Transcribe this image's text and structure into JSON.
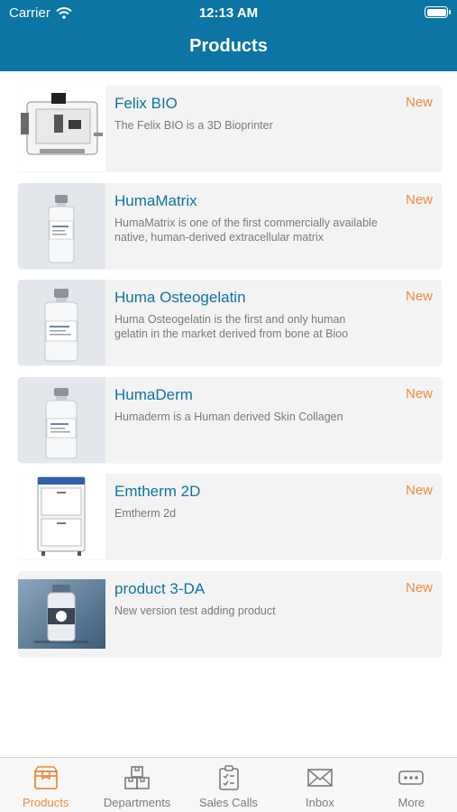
{
  "status_bar": {
    "carrier": "Carrier",
    "time": "12:13 AM"
  },
  "header": {
    "title": "Products"
  },
  "products": [
    {
      "name": "Felix BIO",
      "badge": "New",
      "description": "The Felix BIO is a 3D Bioprinter"
    },
    {
      "name": "HumaMatrix",
      "badge": "New",
      "description": "HumaMatrix is one of the first commercially available native, human-derived extracellular matrix"
    },
    {
      "name": "Huma Osteogelatin",
      "badge": "New",
      "description": "Huma Osteogelatin is the first and only human gelatin in the market derived from bone at Bioo"
    },
    {
      "name": "HumaDerm",
      "badge": "New",
      "description": "Humaderm is a Human derived Skin Collagen"
    },
    {
      "name": "Emtherm 2D",
      "badge": "New",
      "description": "Emtherm 2d"
    },
    {
      "name": "product 3-DA",
      "badge": "New",
      "description": "New version test adding product"
    }
  ],
  "tab_bar": {
    "tabs": [
      {
        "label": "Products",
        "icon": "box-icon",
        "active": true
      },
      {
        "label": "Departments",
        "icon": "boxes-icon",
        "active": false
      },
      {
        "label": "Sales Calls",
        "icon": "clipboard-icon",
        "active": false
      },
      {
        "label": "Inbox",
        "icon": "envelope-icon",
        "active": false
      },
      {
        "label": "More",
        "icon": "more-icon",
        "active": false
      }
    ]
  },
  "colors": {
    "brand": "#0d75a3",
    "accent": "#f08a3c"
  }
}
